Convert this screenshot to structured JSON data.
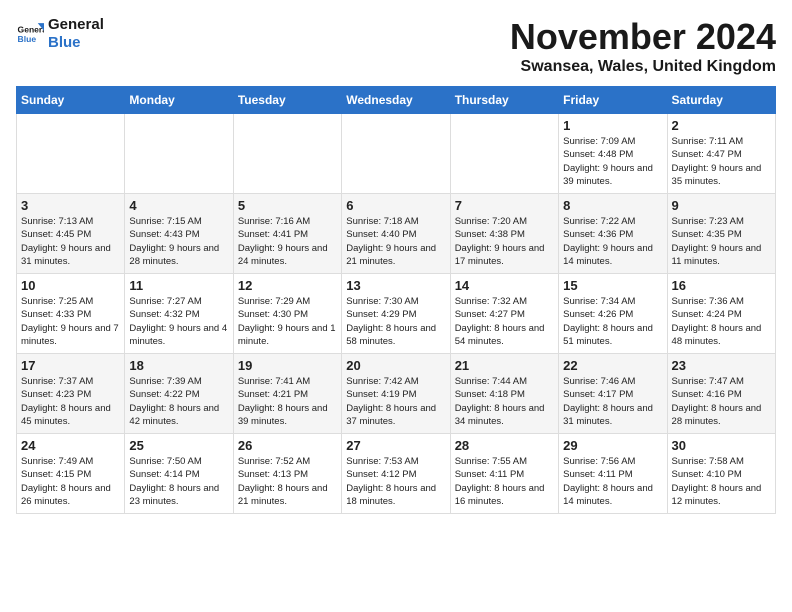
{
  "logo": {
    "line1": "General",
    "line2": "Blue"
  },
  "title": "November 2024",
  "location": "Swansea, Wales, United Kingdom",
  "days_of_week": [
    "Sunday",
    "Monday",
    "Tuesday",
    "Wednesday",
    "Thursday",
    "Friday",
    "Saturday"
  ],
  "weeks": [
    [
      {
        "day": "",
        "info": ""
      },
      {
        "day": "",
        "info": ""
      },
      {
        "day": "",
        "info": ""
      },
      {
        "day": "",
        "info": ""
      },
      {
        "day": "",
        "info": ""
      },
      {
        "day": "1",
        "info": "Sunrise: 7:09 AM\nSunset: 4:48 PM\nDaylight: 9 hours and 39 minutes."
      },
      {
        "day": "2",
        "info": "Sunrise: 7:11 AM\nSunset: 4:47 PM\nDaylight: 9 hours and 35 minutes."
      }
    ],
    [
      {
        "day": "3",
        "info": "Sunrise: 7:13 AM\nSunset: 4:45 PM\nDaylight: 9 hours and 31 minutes."
      },
      {
        "day": "4",
        "info": "Sunrise: 7:15 AM\nSunset: 4:43 PM\nDaylight: 9 hours and 28 minutes."
      },
      {
        "day": "5",
        "info": "Sunrise: 7:16 AM\nSunset: 4:41 PM\nDaylight: 9 hours and 24 minutes."
      },
      {
        "day": "6",
        "info": "Sunrise: 7:18 AM\nSunset: 4:40 PM\nDaylight: 9 hours and 21 minutes."
      },
      {
        "day": "7",
        "info": "Sunrise: 7:20 AM\nSunset: 4:38 PM\nDaylight: 9 hours and 17 minutes."
      },
      {
        "day": "8",
        "info": "Sunrise: 7:22 AM\nSunset: 4:36 PM\nDaylight: 9 hours and 14 minutes."
      },
      {
        "day": "9",
        "info": "Sunrise: 7:23 AM\nSunset: 4:35 PM\nDaylight: 9 hours and 11 minutes."
      }
    ],
    [
      {
        "day": "10",
        "info": "Sunrise: 7:25 AM\nSunset: 4:33 PM\nDaylight: 9 hours and 7 minutes."
      },
      {
        "day": "11",
        "info": "Sunrise: 7:27 AM\nSunset: 4:32 PM\nDaylight: 9 hours and 4 minutes."
      },
      {
        "day": "12",
        "info": "Sunrise: 7:29 AM\nSunset: 4:30 PM\nDaylight: 9 hours and 1 minute."
      },
      {
        "day": "13",
        "info": "Sunrise: 7:30 AM\nSunset: 4:29 PM\nDaylight: 8 hours and 58 minutes."
      },
      {
        "day": "14",
        "info": "Sunrise: 7:32 AM\nSunset: 4:27 PM\nDaylight: 8 hours and 54 minutes."
      },
      {
        "day": "15",
        "info": "Sunrise: 7:34 AM\nSunset: 4:26 PM\nDaylight: 8 hours and 51 minutes."
      },
      {
        "day": "16",
        "info": "Sunrise: 7:36 AM\nSunset: 4:24 PM\nDaylight: 8 hours and 48 minutes."
      }
    ],
    [
      {
        "day": "17",
        "info": "Sunrise: 7:37 AM\nSunset: 4:23 PM\nDaylight: 8 hours and 45 minutes."
      },
      {
        "day": "18",
        "info": "Sunrise: 7:39 AM\nSunset: 4:22 PM\nDaylight: 8 hours and 42 minutes."
      },
      {
        "day": "19",
        "info": "Sunrise: 7:41 AM\nSunset: 4:21 PM\nDaylight: 8 hours and 39 minutes."
      },
      {
        "day": "20",
        "info": "Sunrise: 7:42 AM\nSunset: 4:19 PM\nDaylight: 8 hours and 37 minutes."
      },
      {
        "day": "21",
        "info": "Sunrise: 7:44 AM\nSunset: 4:18 PM\nDaylight: 8 hours and 34 minutes."
      },
      {
        "day": "22",
        "info": "Sunrise: 7:46 AM\nSunset: 4:17 PM\nDaylight: 8 hours and 31 minutes."
      },
      {
        "day": "23",
        "info": "Sunrise: 7:47 AM\nSunset: 4:16 PM\nDaylight: 8 hours and 28 minutes."
      }
    ],
    [
      {
        "day": "24",
        "info": "Sunrise: 7:49 AM\nSunset: 4:15 PM\nDaylight: 8 hours and 26 minutes."
      },
      {
        "day": "25",
        "info": "Sunrise: 7:50 AM\nSunset: 4:14 PM\nDaylight: 8 hours and 23 minutes."
      },
      {
        "day": "26",
        "info": "Sunrise: 7:52 AM\nSunset: 4:13 PM\nDaylight: 8 hours and 21 minutes."
      },
      {
        "day": "27",
        "info": "Sunrise: 7:53 AM\nSunset: 4:12 PM\nDaylight: 8 hours and 18 minutes."
      },
      {
        "day": "28",
        "info": "Sunrise: 7:55 AM\nSunset: 4:11 PM\nDaylight: 8 hours and 16 minutes."
      },
      {
        "day": "29",
        "info": "Sunrise: 7:56 AM\nSunset: 4:11 PM\nDaylight: 8 hours and 14 minutes."
      },
      {
        "day": "30",
        "info": "Sunrise: 7:58 AM\nSunset: 4:10 PM\nDaylight: 8 hours and 12 minutes."
      }
    ]
  ]
}
